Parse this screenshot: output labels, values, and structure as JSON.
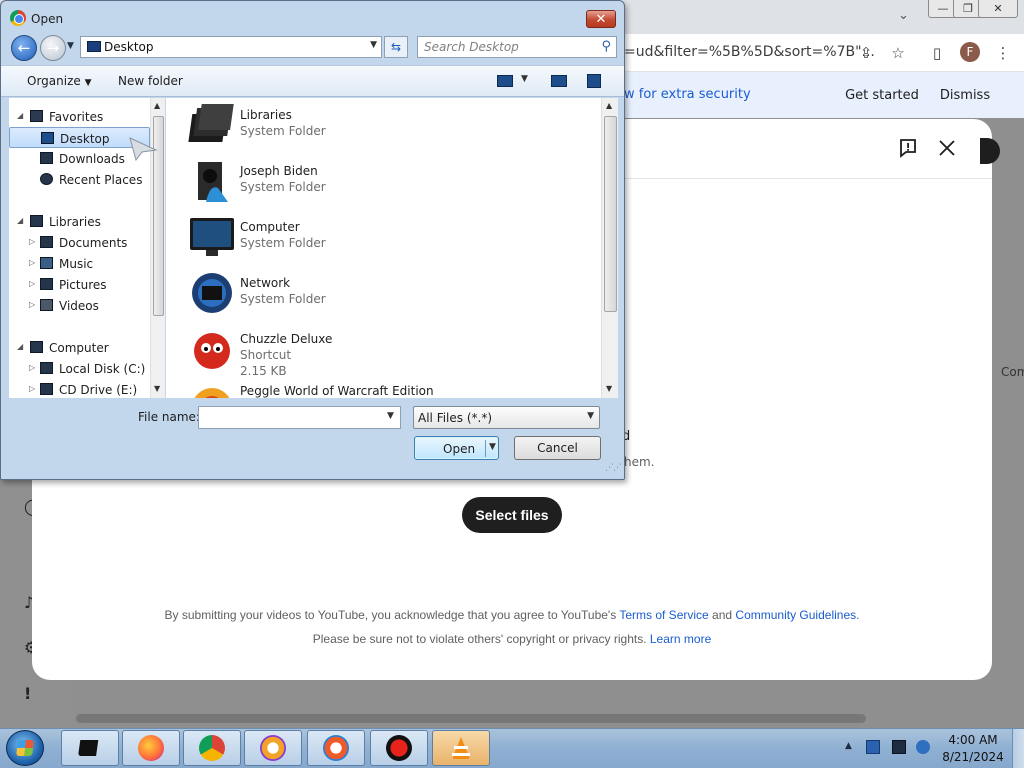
{
  "browser": {
    "url_fragment": "=ud&filter=%5B%5D&sort=%7B\"...",
    "profile_initial": "F",
    "security_banner": "w for extra security",
    "get_started": "Get started",
    "dismiss": "Dismiss",
    "side_text": "Com"
  },
  "youtube_dialog": {
    "partial_line_a": "d",
    "partial_line_b": "hem.",
    "select_files": "Select files",
    "terms_prefix": "By submitting your videos to YouTube, you acknowledge that you agree to YouTube's ",
    "terms_link": "Terms of Service",
    "terms_and": " and ",
    "guidelines_link": "Community Guidelines",
    "terms_suffix": ".",
    "rights_prefix": "Please be sure not to violate others' copyright or privacy rights. ",
    "learn_more": "Learn more"
  },
  "open_dialog": {
    "title": "Open",
    "address": "Desktop",
    "search_placeholder": "Search Desktop",
    "organize": "Organize",
    "new_folder": "New folder",
    "nav": {
      "favorites": "Favorites",
      "desktop": "Desktop",
      "downloads": "Downloads",
      "recent_places": "Recent Places",
      "libraries": "Libraries",
      "documents": "Documents",
      "music": "Music",
      "pictures": "Pictures",
      "videos": "Videos",
      "computer": "Computer",
      "local_disk": "Local Disk (C:)",
      "cd_drive": "CD Drive (E:)"
    },
    "files": [
      {
        "name": "Libraries",
        "type": "System Folder",
        "size": ""
      },
      {
        "name": "Joseph Biden",
        "type": "System Folder",
        "size": ""
      },
      {
        "name": "Computer",
        "type": "System Folder",
        "size": ""
      },
      {
        "name": "Network",
        "type": "System Folder",
        "size": ""
      },
      {
        "name": "Chuzzle Deluxe",
        "type": "Shortcut",
        "size": "2.15 KB"
      },
      {
        "name": "Peggle World of Warcraft Edition",
        "type": "",
        "size": ""
      }
    ],
    "file_name_label": "File name:",
    "file_name_value": "",
    "filter": "All Files (*.*)",
    "open_button": "Open",
    "cancel_button": "Cancel"
  },
  "taskbar": {
    "time": "4:00 AM",
    "date": "8/21/2024"
  }
}
